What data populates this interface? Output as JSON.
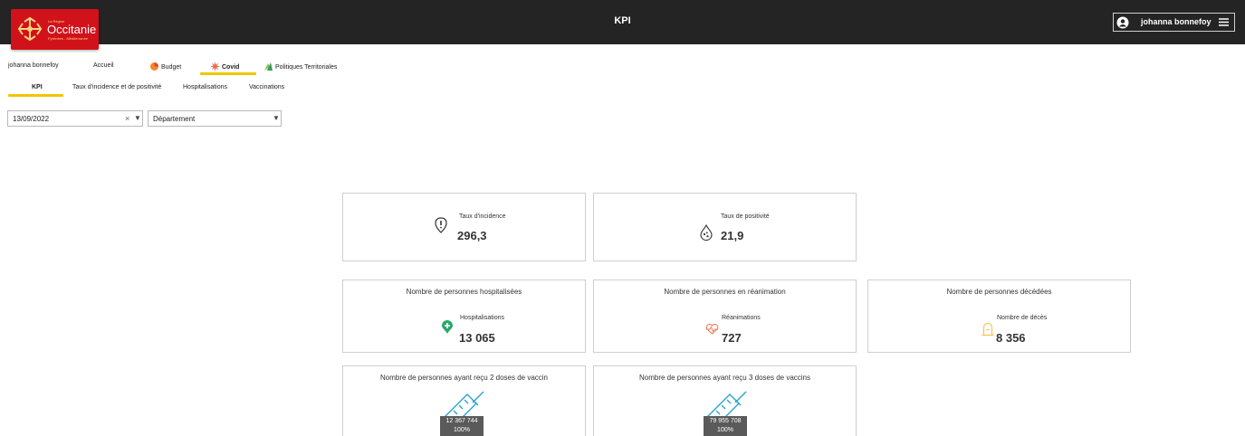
{
  "header": {
    "title": "KPI",
    "logo": {
      "region": "La Région",
      "name": "Occitanie",
      "sub": "Pyrénées - Méditerranée"
    },
    "user": "johanna bonnefoy"
  },
  "nav": {
    "user": "johanna bonnefoy",
    "home": "Accueil",
    "budget": "Budget",
    "covid": "Covid",
    "politiques": "Politiques Territoriales"
  },
  "subnav": {
    "kpi": "KPI",
    "incidence": "Taux d'incidence et de positivité",
    "hospit": "Hospitalisations",
    "vaccin": "Vaccinations"
  },
  "filters": {
    "date": "13/09/2022",
    "clear": "×",
    "department": "Département",
    "arrow": "▼"
  },
  "kpis": {
    "incidence": {
      "label": "Taux d'incidence",
      "value": "296,3"
    },
    "positivite": {
      "label": "Taux de positivité",
      "value": "21,9"
    },
    "hospit": {
      "title": "Nombre de personnes hospitalisées",
      "label": "Hospitalisations",
      "value": "13 065"
    },
    "rea": {
      "title": "Nombre de personnes en réanimation",
      "label": "Réanimations",
      "value": "727"
    },
    "deces": {
      "title": "Nombre de personnes décédées",
      "label": "Nombre de décès",
      "value": "8 356"
    },
    "vacc2": {
      "title": "Nombre de personnes ayant reçu 2 doses de vaccin",
      "value": "12 367 744",
      "pct": "100%",
      "fill": 1.0
    },
    "vacc3": {
      "title": "Nombre de personnes ayant reçu 3 doses de vaccins",
      "value": "79 955 708",
      "pct": "100%",
      "fill": 1.0
    }
  },
  "colors": {
    "header_bg": "#242424",
    "accent": "#f2c500",
    "logo_red": "#d1121b",
    "hospit": "#27a86b",
    "rea": "#f07c5c",
    "deces": "#f2c24d",
    "vaccine": "#2aa3d0"
  },
  "icons": [
    "occitanie-cross-icon",
    "user-avatar-icon",
    "hamburger-menu-icon",
    "budget-icon",
    "covid-virus-icon",
    "politiques-icon",
    "alert-shield-icon",
    "droplet-icon",
    "hospital-pin-icon",
    "heartbeat-icon",
    "tombstone-icon",
    "syringe-icon"
  ]
}
